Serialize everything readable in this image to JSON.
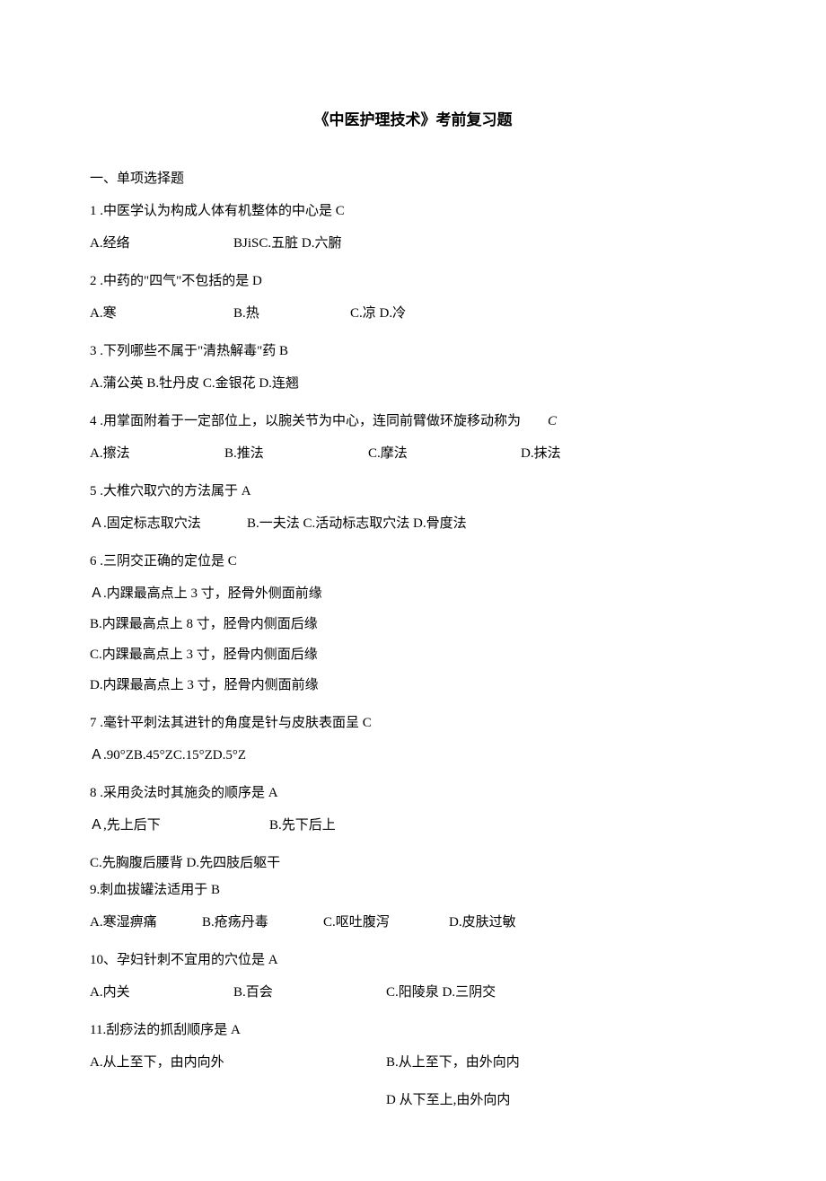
{
  "title": "《中医护理技术》考前复习题",
  "section_header": "一、单项选择题",
  "q1": {
    "text": "1 .中医学认为构成人体有机整体的中心是 C",
    "a": "A.经络",
    "b_cd": "BJiSC.五脏 D.六腑"
  },
  "q2": {
    "text": "2 .中药的\"四气\"不包括的是 D",
    "a": "A.寒",
    "b": "B.热",
    "cd": "C.凉 D.冷"
  },
  "q3": {
    "text": "3 .下列哪些不属于\"清热解毒\"药 B",
    "opts": "A.蒲公英 B.牡丹皮 C.金银花 D.连翘"
  },
  "q4": {
    "text": "4 .用掌面附着于一定部位上，以腕关节为中心，连同前臂做环旋移动称为",
    "answer": "C",
    "a": "A.擦法",
    "b": "B.推法",
    "c": "C.摩法",
    "d": "D.抹法"
  },
  "q5": {
    "text": "5 .大椎穴取穴的方法属于 A",
    "a": "Ａ.固定标志取穴法",
    "rest": "B.一夫法 C.活动标志取穴法 D.骨度法"
  },
  "q6": {
    "text": "6 .三阴交正确的定位是 C",
    "a": "Ａ.内踝最高点上 3 寸，胫骨外侧面前缘",
    "b": "B.内踝最高点上 8 寸，胫骨内侧面后缘",
    "c": "C.内踝最高点上 3 寸，胫骨内侧面后缘",
    "d": "D.内踝最高点上 3 寸，胫骨内侧面前缘"
  },
  "q7": {
    "text": "7 .毫针平刺法其进针的角度是针与皮肤表面呈 C",
    "opts": "Ａ.90°ZB.45°ZC.15°ZD.5°Z"
  },
  "q8": {
    "text": "8 .采用灸法时其施灸的顺序是 A",
    "a": "Ａ,先上后下",
    "b": "B.先下后上",
    "cd": "C.先胸腹后腰背 D.先四肢后躯干"
  },
  "q9": {
    "text": "9.刺血拔罐法适用于 B",
    "a": "A.寒湿痹痛",
    "b": "B.疮疡丹毒",
    "c": "C.呕吐腹泻",
    "d": "D.皮肤过敏"
  },
  "q10": {
    "text": "10、孕妇针刺不宜用的穴位是 A",
    "a": "A.内关",
    "b": "B.百会",
    "cd": "C.阳陵泉 D.三阴交"
  },
  "q11": {
    "text": "11.刮痧法的抓刮顺序是 A",
    "a": "A.从上至下，由内向外",
    "b": "B.从上至下，由外向内",
    "d": "D 从下至上,由外向内"
  }
}
